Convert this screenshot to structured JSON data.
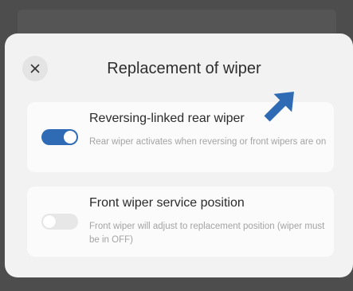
{
  "dialog": {
    "title": "Replacement of wiper",
    "close_icon": "close-icon"
  },
  "settings": [
    {
      "title": "Reversing-linked rear wiper",
      "description": "Rear wiper activates when reversing or front wipers are on",
      "enabled": true
    },
    {
      "title": "Front wiper service position",
      "description": "Front wiper will adjust to replacement position (wiper must be in OFF)",
      "enabled": false
    }
  ],
  "annotation": {
    "icon": "pointer-arrow-icon",
    "color": "#2f6bb5"
  },
  "colors": {
    "accent": "#2f6bb5",
    "backdrop": "#4d4d4d",
    "dialog_bg": "#f2f2f2"
  }
}
